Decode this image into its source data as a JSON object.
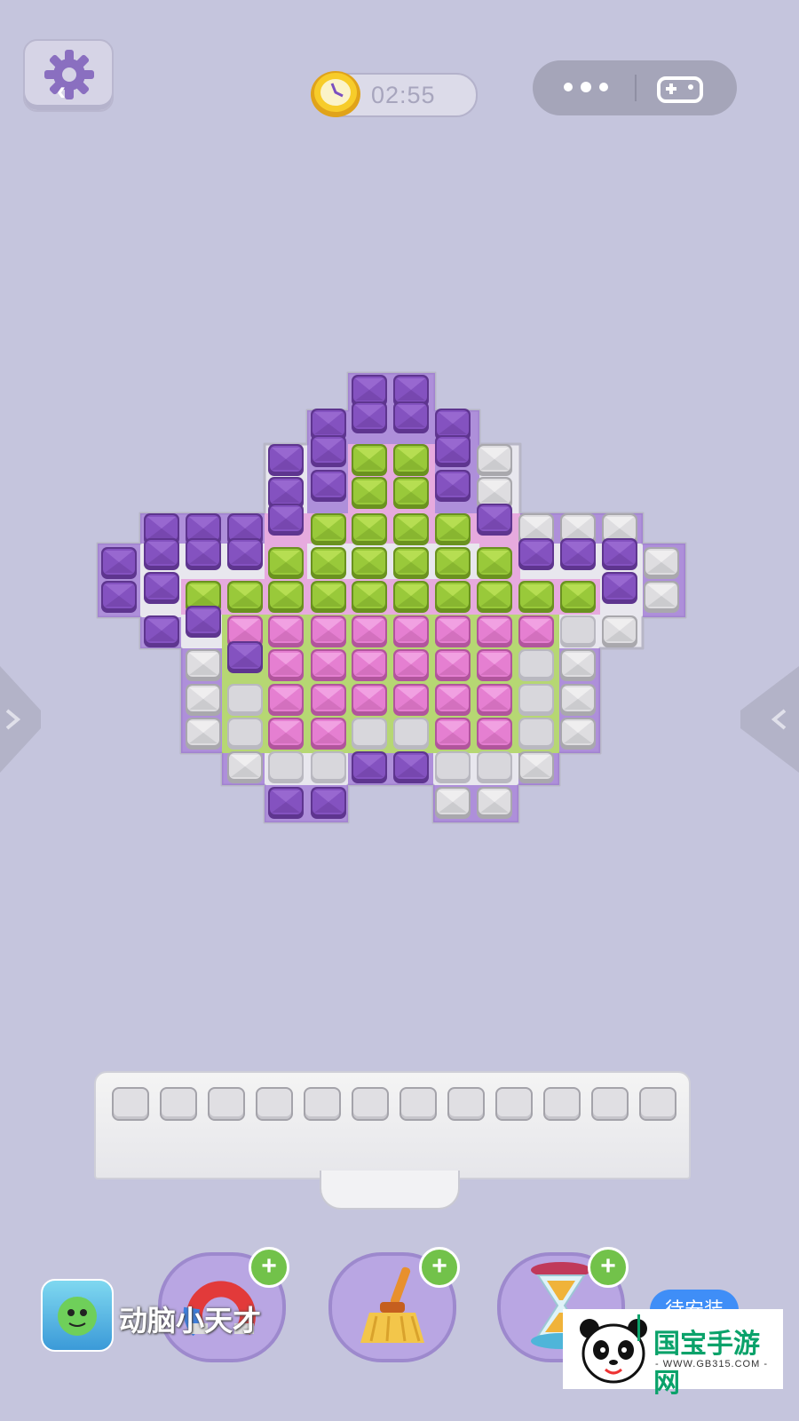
{
  "header": {
    "timer_text": "02:55",
    "settings_icon": "gear-icon",
    "back_icon": "chevron-left-icon",
    "clock_icon": "clock-icon",
    "menu_icons": [
      "more-dots-icon",
      "gamepad-icon"
    ]
  },
  "board": {
    "rows": [
      "..........................",
      "..........................",
      "..........................",
      "..........................",
      "..........................",
      "..........................",
      "..........................",
      "..........................",
      "..........................",
      "..........................",
      "..........................",
      ".........................."
    ]
  },
  "tray": {
    "slot_count": 12
  },
  "boosters": [
    {
      "name": "magnet",
      "icon": "magnet-icon",
      "badge": "+"
    },
    {
      "name": "broom",
      "icon": "broom-icon",
      "badge": "+"
    },
    {
      "name": "hourglass",
      "icon": "hourglass-icon",
      "badge": "+"
    }
  ],
  "ad": {
    "app_name": "动脑小天才",
    "install_label": "待安装"
  },
  "watermark": {
    "brand": "国宝手游网",
    "url": "- WWW.GB315.COM -"
  },
  "colors": {
    "purple": "#8f5cc6",
    "green": "#a6d63c",
    "pink": "#ea8fd6",
    "white": "#e9e8ea",
    "background": "#c5c5dd"
  }
}
